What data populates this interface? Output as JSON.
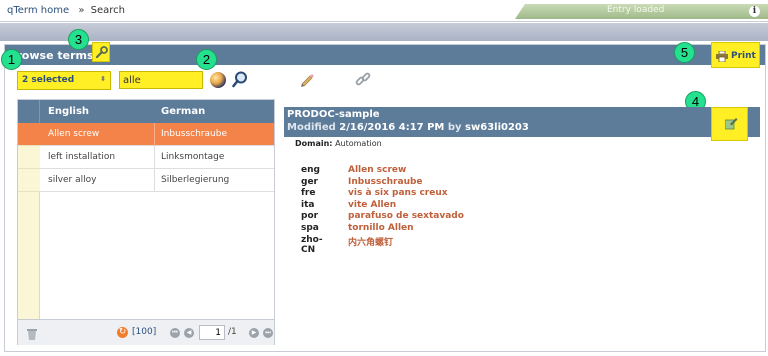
{
  "breadcrumb": {
    "home": "qTerm home",
    "separator": "»",
    "current": "Search"
  },
  "status": {
    "text": "Entry loaded",
    "info_icon": "i"
  },
  "panel": {
    "title": "Browse terms",
    "print_label": "Print"
  },
  "badges": [
    "1",
    "2",
    "3",
    "4",
    "5"
  ],
  "toolbar": {
    "selection_label": "2 selected",
    "search_value": "alle"
  },
  "grid": {
    "columns": [
      "English",
      "German"
    ],
    "rows": [
      {
        "english": "Allen screw",
        "german": "Inbusschraube",
        "selected": true
      },
      {
        "english": "left installation",
        "german": "Linksmontage",
        "selected": false
      },
      {
        "english": "silver alloy",
        "german": "Silberlegierung",
        "selected": false
      }
    ],
    "pager": {
      "rows_per_page": "[100]",
      "page": "1",
      "total": "/1"
    }
  },
  "entry": {
    "title": "PRODOC-sample",
    "modified_label": "Modified",
    "modified_date": "2/16/2016 4:17 PM",
    "by_label": "by",
    "author": "sw63li0203",
    "domain_label": "Domain:",
    "domain_value": "Automation",
    "terms": [
      {
        "lang": "eng",
        "text": "Allen screw"
      },
      {
        "lang": "ger",
        "text": "Inbusschraube"
      },
      {
        "lang": "fre",
        "text": "vis à six pans creux"
      },
      {
        "lang": "ita",
        "text": "vite Allen"
      },
      {
        "lang": "por",
        "text": "parafuso de sextavado"
      },
      {
        "lang": "spa",
        "text": "tornillo Allen"
      },
      {
        "lang": "zho-CN",
        "text": "内六角螺钉"
      }
    ]
  },
  "colors": {
    "header_blue": "#5d7c9a",
    "highlight_yellow": "#ffef24",
    "selection_orange": "#f4834a",
    "badge_green": "#25e08e",
    "term_text": "#c0603a",
    "link_blue": "#2d4f7a"
  },
  "icons": [
    "wrench-icon",
    "print-icon",
    "globe-icon",
    "magnifier-icon",
    "pencil-icon",
    "link-icon",
    "trash-icon",
    "refresh-icon",
    "edit-icon",
    "info-icon"
  ]
}
